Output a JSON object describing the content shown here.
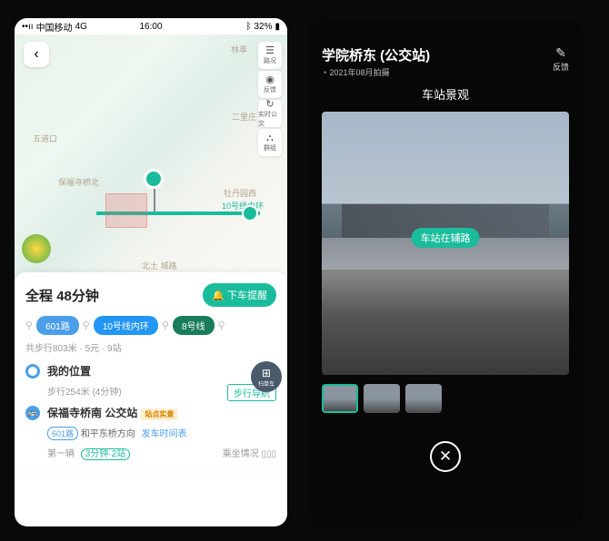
{
  "statusbar": {
    "carrier": "中国移动",
    "network": "4G",
    "time": "16:00",
    "bluetooth": "ᛒ",
    "battery": "32%"
  },
  "map": {
    "back": "‹",
    "tools": [
      {
        "icon": "☰",
        "label": "路况"
      },
      {
        "icon": "◉",
        "label": "反馈"
      },
      {
        "icon": "↻",
        "label": "实时公交"
      },
      {
        "icon": "⛬",
        "label": "群组"
      }
    ],
    "roads": {
      "wudaokou": "五道口",
      "linhua": "林萃",
      "erligou": "二里庄",
      "mudanyuanxi": "牡丹园西",
      "line10": "10号线内环",
      "baofu": "保福寺桥北",
      "beitu": "北土 城路"
    }
  },
  "panel": {
    "total_label": "全程",
    "duration": "48分钟",
    "alert": "下车提醒",
    "chips": {
      "bus601": "601路",
      "line10": "10号线内环",
      "line8": "8号线"
    },
    "meta": "共步行803米 · 5元 · 9站",
    "scan": "扫单车",
    "step1": {
      "title": "我的位置",
      "sub": "步行254米 (4分钟)",
      "walkNav": "步行导航"
    },
    "step2": {
      "title": "保福寺桥南 公交站",
      "rt": "站点实景",
      "route": "601路",
      "dir": "和平东桥方向",
      "timetable": "发车时间表",
      "first": "第一辆",
      "eta": "3分钟·2站",
      "seat": "乘坐情况"
    }
  },
  "right": {
    "title": "学院桥东 (公交站)",
    "date": "2021年08月拍摄",
    "feedback": "反馈",
    "subtitle": "车站景观",
    "photoLabel": "车站在辅路",
    "close": "✕"
  }
}
